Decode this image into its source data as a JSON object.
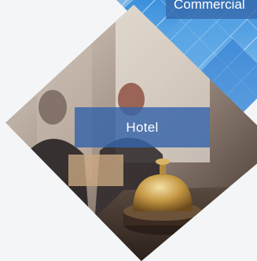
{
  "tiles": {
    "commercial": {
      "label": "Commercial",
      "icon": "building-photo"
    },
    "hotel": {
      "label": "Hotel",
      "icon": "hotel-bell-photo"
    }
  },
  "colors": {
    "label_background": "#3664aa",
    "label_text": "#ffffff",
    "page_background": "#f4f5f7"
  }
}
